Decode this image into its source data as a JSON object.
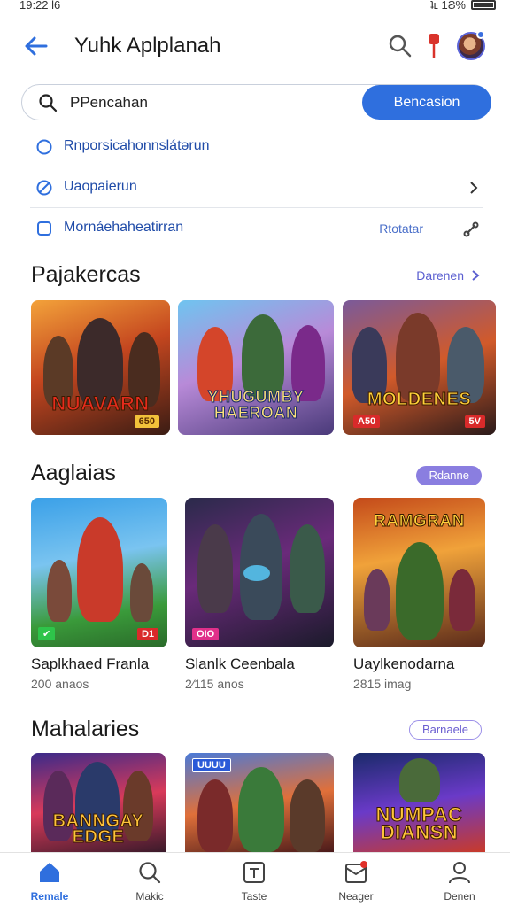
{
  "status": {
    "time": "19:22 Ɩ6",
    "battery_text": "ʇʟ 1Ϩ%"
  },
  "app_bar": {
    "title": "Yuhk Aplplanah"
  },
  "search": {
    "value": "PPencahan",
    "button_label": "Bencasion"
  },
  "suggestions": [
    {
      "label": "Rnporsicahonnslátərun",
      "icon": "circle-icon"
    },
    {
      "label": "Uaopaierun",
      "icon": "slash-circle-icon",
      "trail": "chevron"
    },
    {
      "label": "Mornáehaheatirran",
      "icon": "square-icon",
      "trail_text": "Rtotatar"
    }
  ],
  "sections": [
    {
      "title": "Pajakercas",
      "link_label": "Darenen"
    },
    {
      "title": "Aaglaias",
      "chip_label": "Rdanne"
    },
    {
      "title": "Mahalaries",
      "chip_label": "Barnaele"
    }
  ],
  "row1": [
    {
      "title": "NUAVARN",
      "badge": "650"
    },
    {
      "title": "YHUGUMBY HAEROAN",
      "badge": ""
    },
    {
      "title": "MOLDENES",
      "badge_left": "A50",
      "badge": "5V"
    }
  ],
  "row2": [
    {
      "name": "Saplkhaed Franla",
      "meta": "200 anaos",
      "badge_left": "✔",
      "badge": "D1"
    },
    {
      "name": "Slanlk Ceenbala",
      "meta": "2⁄115 anos",
      "badge_left": "OIO"
    },
    {
      "name": "Uaylkenodarna",
      "meta": "2815 imag",
      "title": "RAMGRAN"
    }
  ],
  "row3": [
    {
      "title": "BANNGAY EDGE"
    },
    {
      "title": "",
      "badge_top": "UUUU"
    },
    {
      "title": "NUMPAC DIANSN"
    }
  ],
  "bottom_nav": [
    {
      "label": "Remale",
      "icon": "home-icon"
    },
    {
      "label": "Makic",
      "icon": "search-icon"
    },
    {
      "label": "Taste",
      "icon": "tile-icon"
    },
    {
      "label": "Neager",
      "icon": "inbox-icon"
    },
    {
      "label": "Denen",
      "icon": "person-icon"
    }
  ],
  "colors": {
    "accent": "#2f6fde",
    "chip": "#8a7ee0"
  }
}
